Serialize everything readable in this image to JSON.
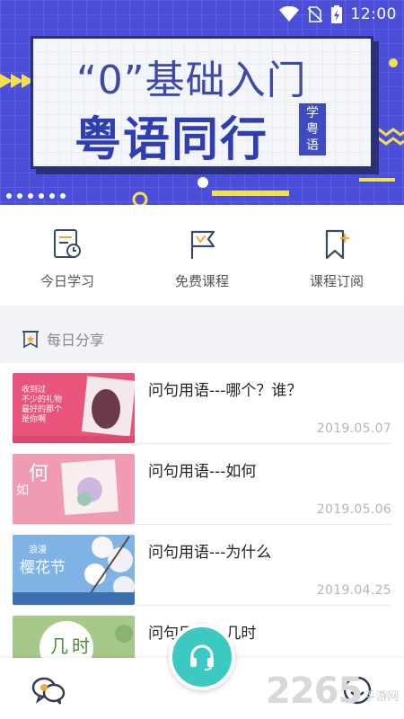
{
  "status_bar": {
    "time": "12:00"
  },
  "banner": {
    "line1": "“0”基础入门",
    "line2": "粤语同行",
    "badge": [
      "学",
      "粤",
      "语"
    ],
    "colors": {
      "background": "#4a4ed8",
      "card": "#f5f6fb",
      "accent_yellow": "#f4e04d"
    }
  },
  "quick_menu": [
    {
      "label": "今日学习",
      "icon": "calendar-clock-icon"
    },
    {
      "label": "免费课程",
      "icon": "flag-icon"
    },
    {
      "label": "课程订阅",
      "icon": "bookmark-plus-icon"
    }
  ],
  "daily_share": {
    "title": "每日分享",
    "icon": "star-banner-icon"
  },
  "articles": [
    {
      "title": "问句用语---哪个？谁？",
      "date": "2019.05.07",
      "thumb_text": [
        "收到过",
        "不少的礼物",
        "最好的那个",
        "是你啊"
      ]
    },
    {
      "title": "问句用语---如何",
      "date": "2019.05.06",
      "thumb_text": [
        "何",
        "如"
      ]
    },
    {
      "title": "问句用语---为什么",
      "date": "2019.04.25",
      "thumb_text": [
        "浪漫",
        "樱花节"
      ]
    },
    {
      "title": "问句用语---几时",
      "date": "",
      "thumb_text": [
        "几",
        "时"
      ]
    }
  ],
  "bottom_nav": {
    "left_icon": "chat-bubbles-icon",
    "center_icon": "headset-icon",
    "right_icon": "profile-icon",
    "fab_color": "#3cc9c2"
  },
  "watermark": {
    "number": "2265",
    "text": "手游网"
  }
}
